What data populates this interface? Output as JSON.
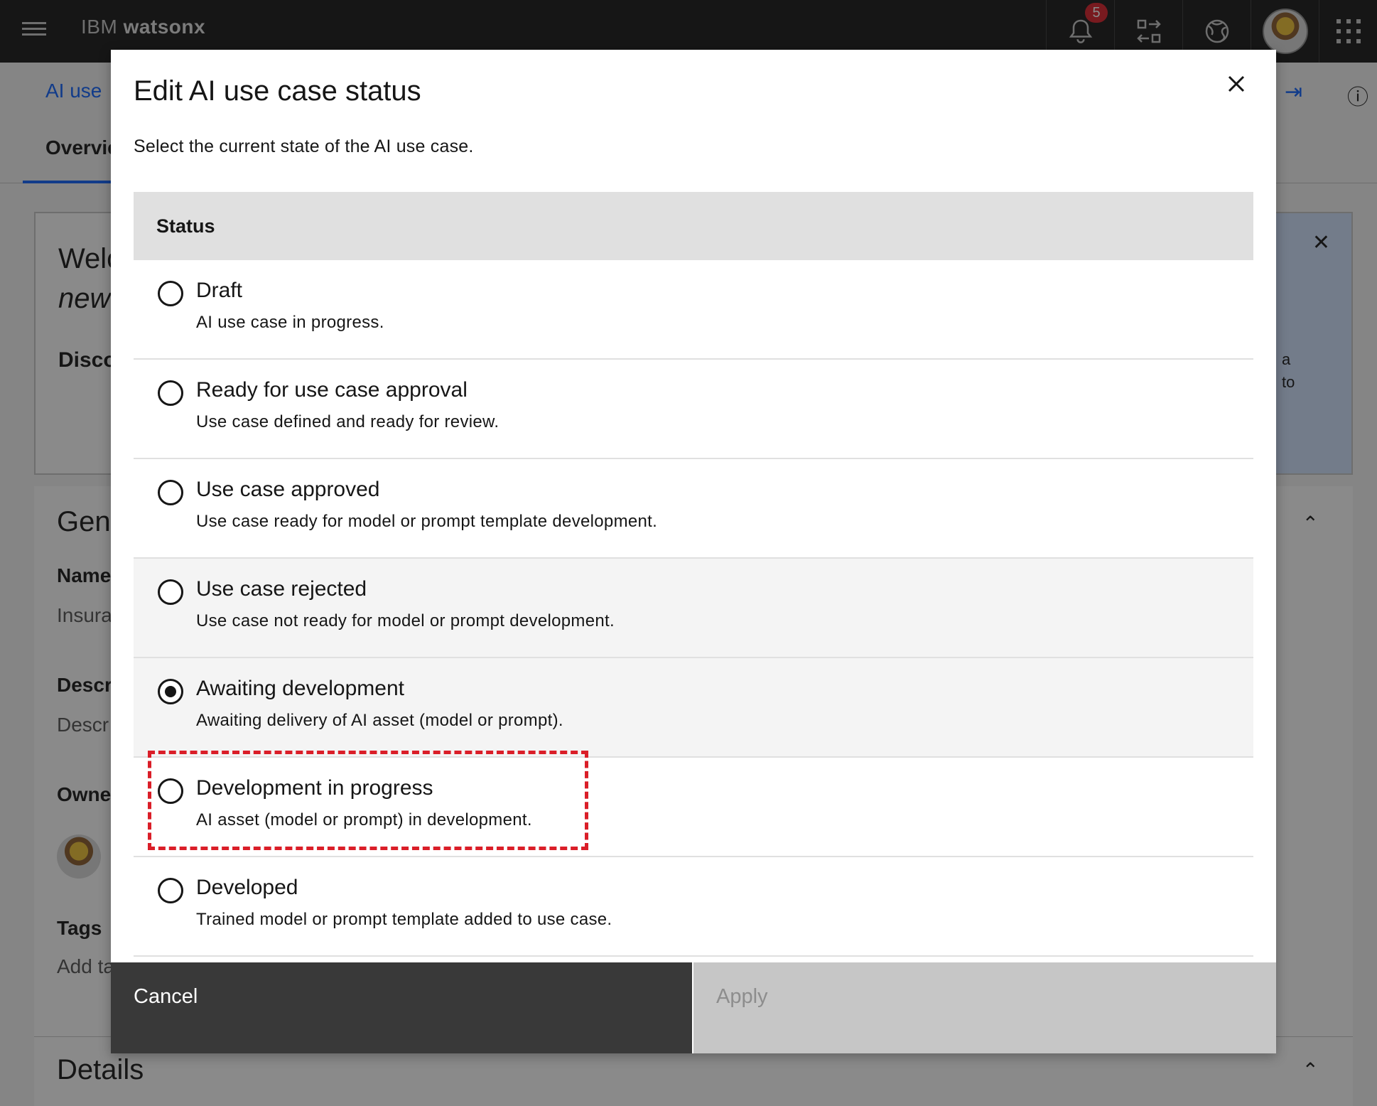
{
  "header": {
    "brand_prefix": "IBM",
    "brand_name": "watsonx",
    "notification_count": "5"
  },
  "background": {
    "breadcrumb": "AI use",
    "tab": "Overvie",
    "welcome_line1": "Welc",
    "welcome_line2": "new",
    "discover": "Disco",
    "side_text_line1": "a",
    "side_text_line2": "to",
    "section_title": "Gene",
    "name_label": "Name",
    "name_value": "Insura",
    "description_label": "Descr",
    "description_value": "Descr",
    "owner_label": "Owne",
    "tags_label": "Tags",
    "tags_value": "Add ta",
    "details_title": "Details"
  },
  "modal": {
    "title": "Edit AI use case status",
    "description": "Select the current state of the AI use case.",
    "table_header": "Status",
    "options": [
      {
        "label": "Draft",
        "sub": "AI use case in progress.",
        "checked": false
      },
      {
        "label": "Ready for use case approval",
        "sub": "Use case defined and ready for review.",
        "checked": false
      },
      {
        "label": "Use case approved",
        "sub": "Use case ready for model or prompt template development.",
        "checked": false
      },
      {
        "label": "Use case rejected",
        "sub": "Use case not ready for model or prompt development.",
        "checked": false
      },
      {
        "label": "Awaiting development",
        "sub": "Awaiting delivery of AI asset (model or prompt).",
        "checked": true
      },
      {
        "label": "Development in progress",
        "sub": "AI asset (model or prompt) in development.",
        "checked": false
      },
      {
        "label": "Developed",
        "sub": "Trained model or prompt template added to use case.",
        "checked": false
      }
    ],
    "cancel_label": "Cancel",
    "apply_label": "Apply"
  },
  "colors": {
    "header_bg": "#161616",
    "interactive": "#0f62fe",
    "highlight": "#da1e28",
    "cancel_bg": "#393939",
    "apply_disabled_bg": "#c6c6c6"
  }
}
